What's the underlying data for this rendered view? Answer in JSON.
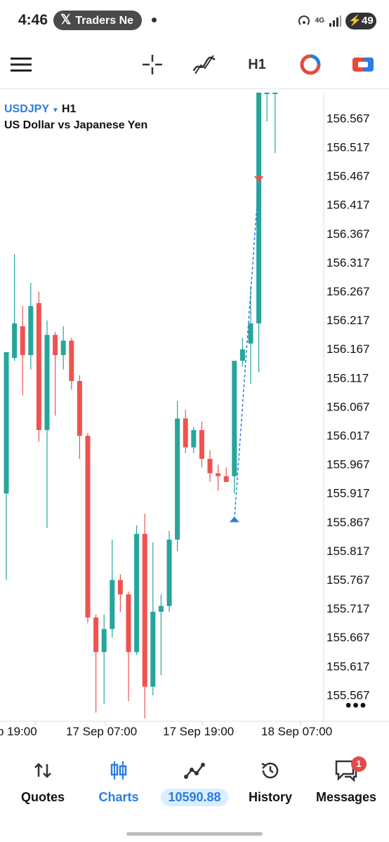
{
  "status_bar": {
    "time": "4:46",
    "notification_app": "Traders Ne",
    "network": "4G",
    "battery": "49"
  },
  "toolbar": {
    "menu_icon": "hamburger-icon",
    "crosshair_icon": "crosshair-icon",
    "indicators_icon": "indicators-icon",
    "timeframe": "H1",
    "objects_icon": "objects-icon",
    "trade_icon": "trade-icon"
  },
  "chart": {
    "symbol": "USDJPY",
    "timeframe": "H1",
    "description": "US Dollar vs Japanese Yen",
    "more": "•••",
    "colors": {
      "bull": "#26a69a",
      "bear": "#ef5350",
      "trade_line": "#2a7de1"
    }
  },
  "chart_data": {
    "type": "candlestick",
    "x_tick_labels": [
      "p 19:00",
      "17 Sep 07:00",
      "17 Sep 19:00",
      "18 Sep 07:00"
    ],
    "y_tick_labels": [
      "156.567",
      "156.517",
      "156.467",
      "156.417",
      "156.367",
      "156.317",
      "156.267",
      "156.217",
      "156.167",
      "156.117",
      "156.067",
      "156.017",
      "155.967",
      "155.917",
      "155.867",
      "155.817",
      "155.767",
      "155.717",
      "155.667",
      "155.617",
      "155.567"
    ],
    "ylim": [
      155.52,
      156.61
    ],
    "candles": [
      {
        "o": 155.915,
        "h": 156.16,
        "l": 155.765,
        "c": 156.16
      },
      {
        "o": 156.15,
        "h": 156.33,
        "l": 156.145,
        "c": 156.21
      },
      {
        "o": 156.205,
        "h": 156.24,
        "l": 156.085,
        "c": 156.155
      },
      {
        "o": 156.155,
        "h": 156.28,
        "l": 156.13,
        "c": 156.24
      },
      {
        "o": 156.245,
        "h": 156.265,
        "l": 156.005,
        "c": 156.025
      },
      {
        "o": 156.025,
        "h": 156.215,
        "l": 155.855,
        "c": 156.19
      },
      {
        "o": 156.19,
        "h": 156.195,
        "l": 156.05,
        "c": 156.155
      },
      {
        "o": 156.155,
        "h": 156.205,
        "l": 156.13,
        "c": 156.18
      },
      {
        "o": 156.18,
        "h": 156.185,
        "l": 156.095,
        "c": 156.11
      },
      {
        "o": 156.11,
        "h": 156.12,
        "l": 155.975,
        "c": 156.015
      },
      {
        "o": 156.015,
        "h": 156.02,
        "l": 155.69,
        "c": 155.7
      },
      {
        "o": 155.7,
        "h": 155.705,
        "l": 155.535,
        "c": 155.64
      },
      {
        "o": 155.64,
        "h": 155.705,
        "l": 155.55,
        "c": 155.68
      },
      {
        "o": 155.68,
        "h": 155.835,
        "l": 155.665,
        "c": 155.765
      },
      {
        "o": 155.765,
        "h": 155.775,
        "l": 155.71,
        "c": 155.74
      },
      {
        "o": 155.74,
        "h": 155.745,
        "l": 155.555,
        "c": 155.64
      },
      {
        "o": 155.64,
        "h": 155.86,
        "l": 155.635,
        "c": 155.845
      },
      {
        "o": 155.845,
        "h": 155.88,
        "l": 155.525,
        "c": 155.58
      },
      {
        "o": 155.58,
        "h": 155.83,
        "l": 155.565,
        "c": 155.71
      },
      {
        "o": 155.71,
        "h": 155.74,
        "l": 155.6,
        "c": 155.72
      },
      {
        "o": 155.72,
        "h": 155.85,
        "l": 155.71,
        "c": 155.835
      },
      {
        "o": 155.835,
        "h": 156.075,
        "l": 155.815,
        "c": 156.045
      },
      {
        "o": 156.045,
        "h": 156.06,
        "l": 155.985,
        "c": 155.995
      },
      {
        "o": 155.995,
        "h": 156.03,
        "l": 155.985,
        "c": 156.025
      },
      {
        "o": 156.025,
        "h": 156.04,
        "l": 155.96,
        "c": 155.975
      },
      {
        "o": 155.975,
        "h": 155.99,
        "l": 155.935,
        "c": 155.95
      },
      {
        "o": 155.95,
        "h": 155.965,
        "l": 155.92,
        "c": 155.945
      },
      {
        "o": 155.945,
        "h": 155.96,
        "l": 155.935,
        "c": 155.935
      },
      {
        "o": 155.945,
        "h": 156.145,
        "l": 155.915,
        "c": 156.145
      },
      {
        "o": 156.145,
        "h": 156.185,
        "l": 156.135,
        "c": 156.165
      },
      {
        "o": 156.175,
        "h": 156.275,
        "l": 156.105,
        "c": 156.21
      },
      {
        "o": 156.21,
        "h": 156.61,
        "l": 156.125,
        "c": 156.61
      },
      {
        "o": 156.61,
        "h": 156.61,
        "l": 156.56,
        "c": 156.61
      },
      {
        "o": 156.61,
        "h": 156.61,
        "l": 156.505,
        "c": 156.61
      }
    ],
    "trade": {
      "open_price": 155.87,
      "close_price": 156.46
    }
  },
  "bottom_nav": {
    "quotes": "Quotes",
    "charts": "Charts",
    "balance": "10590.88",
    "history": "History",
    "messages": "Messages",
    "messages_badge": "1"
  }
}
